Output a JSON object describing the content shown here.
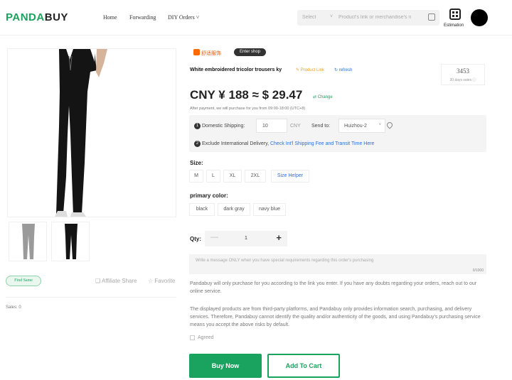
{
  "header": {
    "logo_part1": "PANDA",
    "logo_part2": "BUY",
    "nav": {
      "home": "Home",
      "forwarding": "Forwarding",
      "diy_orders": "DIY Orders"
    },
    "search": {
      "select_label": "Select",
      "placeholder": "Product's link or merchandise's n"
    },
    "estimation_label": "Estimation"
  },
  "gallery": {
    "find_same_label": "Find Same",
    "affiliate_share_label": "Affiliate Share",
    "favorite_label": "Favorite",
    "sales_label": "Sales: 0"
  },
  "product": {
    "shop_name": "舒适服饰",
    "enter_shop_label": "Enter shop",
    "title": "White embroidered tricolor trousers ky",
    "product_link_label": "Product Link",
    "refresh_label": "refresh",
    "sold_count": "3453",
    "sold_label": "30 days sales",
    "price": "CNY ¥ 188 ≈ $ 29.47",
    "change_label": "Change",
    "after_payment_note": "After payment, we will purchase for you from 09:00-18:00 (UTC+8)"
  },
  "shipping": {
    "step1_num": "1",
    "step2_num": "2",
    "domestic_label": "Domestic Shipping:",
    "domestic_value": "10",
    "currency_unit": "CNY",
    "send_to_label": "Send to:",
    "send_to_value": "Huizhou-2",
    "exclude_text": "Exclude International Delivery,",
    "check_link": "Check Int'l Shipping Fee and Transit Time Here"
  },
  "options": {
    "size_label": "Size:",
    "sizes": [
      "M",
      "L",
      "XL",
      "2XL"
    ],
    "size_helper_label": "Size Helper",
    "color_label": "primary color:",
    "colors": [
      "black",
      "dark gray",
      "navy blue"
    ]
  },
  "quantity": {
    "label": "Qty:",
    "minus": "—",
    "value": "1",
    "plus": "+"
  },
  "message": {
    "placeholder": "Write a message ONLY when you have special requirements regarding this order's purchasing",
    "counter": "0/1000"
  },
  "notices": {
    "line1": "Pandabuy will only purchase for you according to the link you enter. If you have any doubts regarding your orders, reach out to our online service.",
    "line2": "The displayed products are from third-party platforms, and Pandabuy only provides information search, purchasing, and delivery services. Therefore, Pandabuy cannot identify the quality and/or authenticity of the goods, and using Pandabuy's purchasing service means you accept the above risks by default.",
    "agreed_label": "Agreed"
  },
  "actions": {
    "buy_now_label": "Buy Now",
    "add_to_cart_label": "Add To Cart"
  },
  "colors": {
    "brand_green": "#1aa35e",
    "link_blue": "#2f6fd6",
    "shop_orange": "#ff6a00"
  }
}
